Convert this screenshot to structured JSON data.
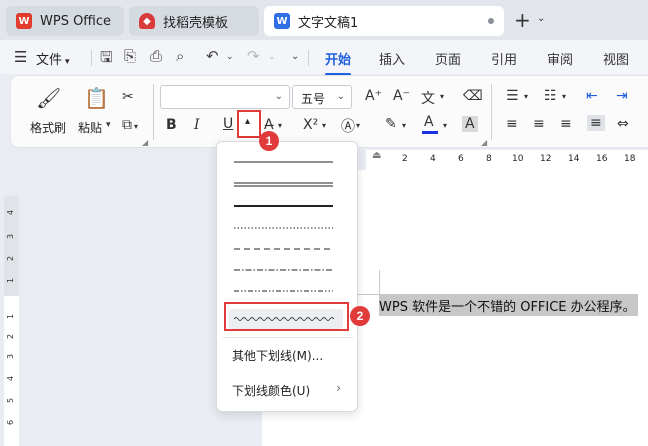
{
  "tabs": [
    {
      "label": "WPS Office",
      "icon": "wps-logo-icon"
    },
    {
      "label": "找稻壳模板",
      "icon": "docer-icon"
    },
    {
      "label": "文字文稿1",
      "icon": "writer-doc-icon"
    }
  ],
  "menubar": {
    "file_label": "文件",
    "ribbon_tabs": [
      "开始",
      "插入",
      "页面",
      "引用",
      "审阅",
      "视图"
    ]
  },
  "ribbon": {
    "format_painter": "格式刷",
    "paste": "粘贴",
    "font_name": "",
    "font_size": "五号"
  },
  "document": {
    "text": "WPS 软件是一个不错的 OFFICE 办公程序。"
  },
  "ruler": {
    "h_numbers": [
      "2",
      "4",
      "6",
      "8",
      "10",
      "12",
      "14",
      "16",
      "18"
    ],
    "v_numbers": [
      "4",
      "3",
      "2",
      "1",
      "1",
      "2",
      "3",
      "4",
      "5",
      "6"
    ]
  },
  "dropdown": {
    "more_underlines": "其他下划线(M)...",
    "underline_color": "下划线颜色(U)"
  },
  "annotations": [
    "1",
    "2"
  ],
  "colors": {
    "accent": "#1f5fe0",
    "annotation_red": "#e03a3a",
    "font_color_bar": "#1a2ee8"
  }
}
